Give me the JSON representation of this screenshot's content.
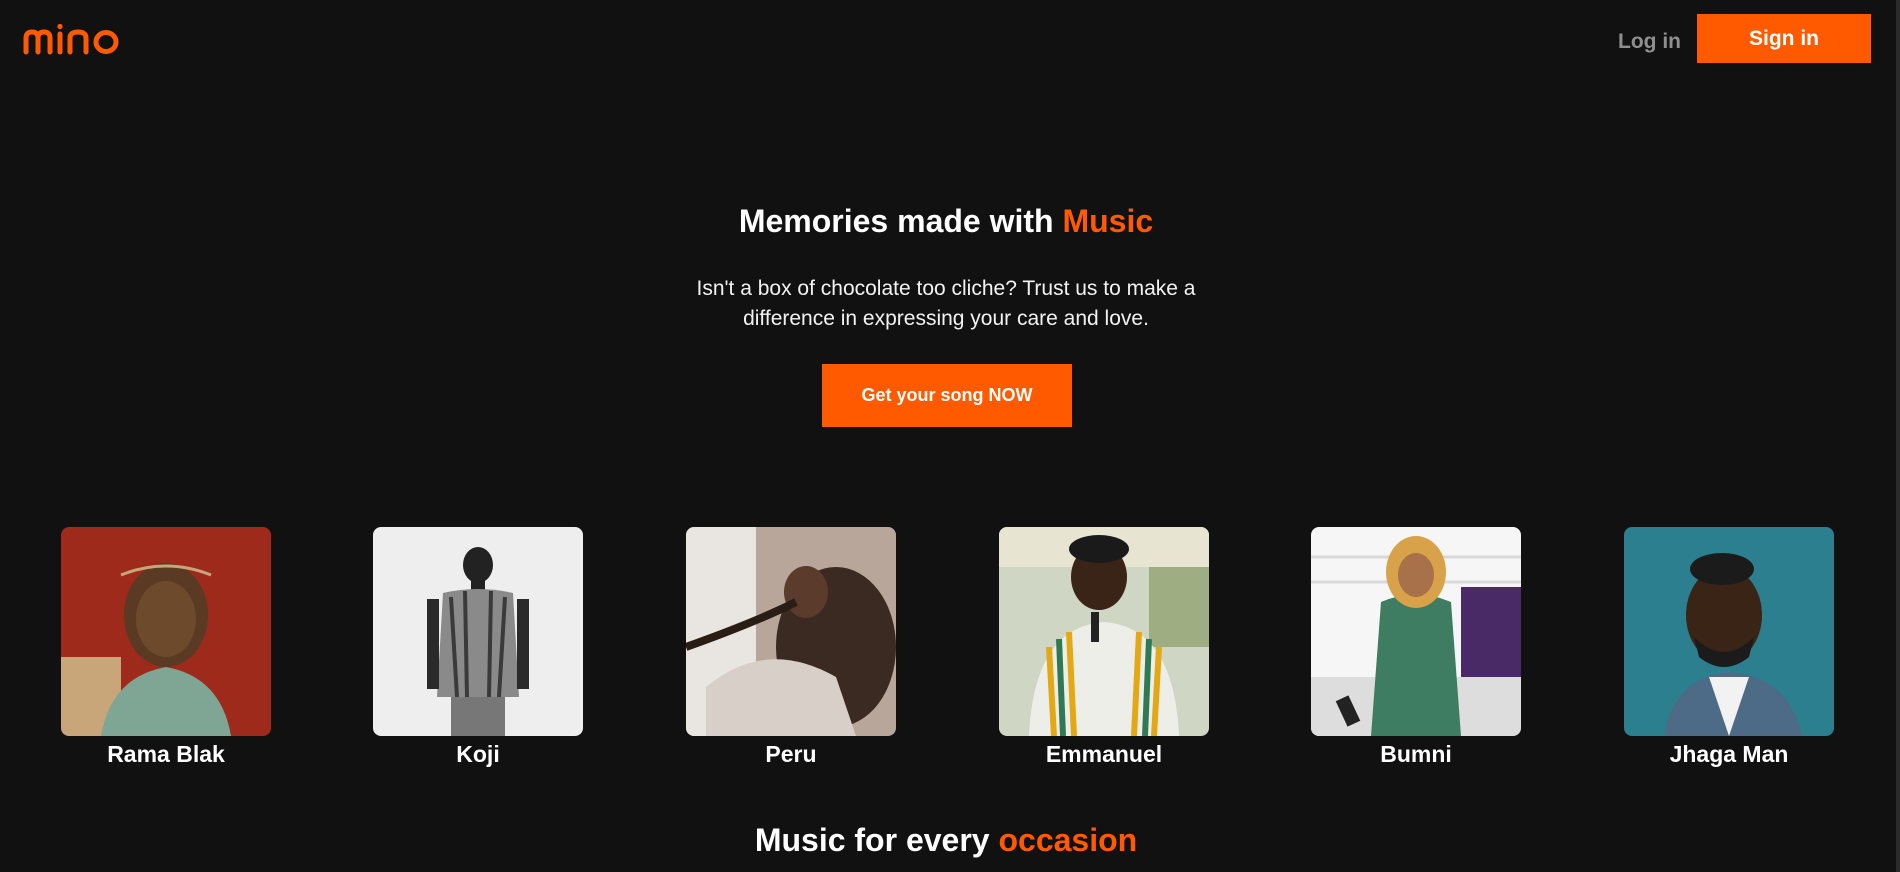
{
  "header": {
    "logo_text": "mino",
    "login_label": "Log in",
    "signin_label": "Sign in"
  },
  "hero": {
    "title_prefix": "Memories made with ",
    "title_accent": "Music",
    "subtitle": "Isn't a box of chocolate too cliche? Trust us to make a difference in expressing your care and love.",
    "cta_label": "Get your song NOW"
  },
  "artists": [
    {
      "name": "Rama Blak"
    },
    {
      "name": "Koji"
    },
    {
      "name": "Peru"
    },
    {
      "name": "Emmanuel"
    },
    {
      "name": "Bumni"
    },
    {
      "name": "Jhaga Man"
    }
  ],
  "occasions": {
    "title_prefix": "Music for every ",
    "title_accent": "occasion"
  },
  "colors": {
    "background": "#111111",
    "accent": "#ff5a00",
    "muted": "#8f8f8f"
  }
}
